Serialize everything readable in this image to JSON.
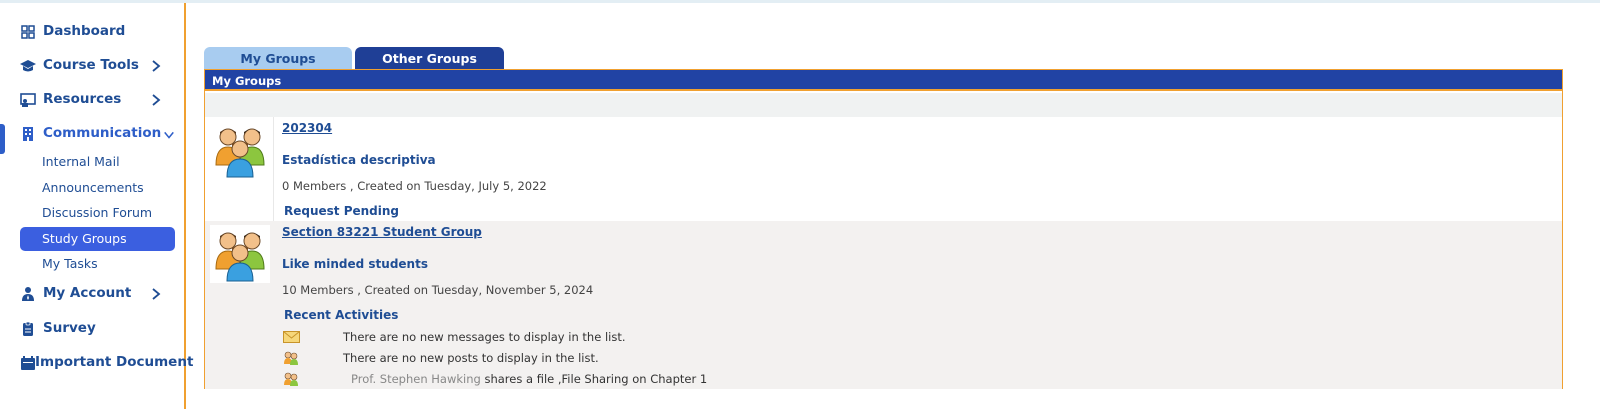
{
  "sidebar": {
    "items": [
      {
        "label": "Dashboard",
        "icon": "grid-icon"
      },
      {
        "label": "Course Tools",
        "icon": "graduation-cap-icon"
      },
      {
        "label": "Resources",
        "icon": "presentation-icon"
      },
      {
        "label": "Communication",
        "icon": "building-icon"
      },
      {
        "label": "My Account",
        "icon": "user-tie-icon"
      },
      {
        "label": "Survey",
        "icon": "clipboard-icon"
      },
      {
        "label": "Important Document",
        "icon": "calendar-icon"
      }
    ],
    "communication_sub": [
      {
        "label": "Internal Mail"
      },
      {
        "label": "Announcements"
      },
      {
        "label": "Discussion Forum"
      },
      {
        "label": "Study Groups"
      },
      {
        "label": "My Tasks"
      }
    ]
  },
  "tabs": {
    "my_groups": "My Groups",
    "other_groups": "Other Groups"
  },
  "panel": {
    "title": "My Groups"
  },
  "groups": [
    {
      "name": "202304",
      "description": "Estadística descriptiva",
      "meta": "0 Members , Created on Tuesday, July 5, 2022",
      "status": "Request Pending"
    },
    {
      "name": "Section 83221 Student Group",
      "description": "Like minded students",
      "meta": "10 Members , Created on Tuesday, November 5, 2024",
      "status": "Recent Activities",
      "activities": [
        {
          "icon": "envelope-icon",
          "text": "There are no new messages to display in the list."
        },
        {
          "icon": "people-icon",
          "text": "There are no new posts to display in the list."
        },
        {
          "icon": "people-icon",
          "author": "Prof. Stephen Hawking",
          "text": " shares a file ,File Sharing on Chapter 1"
        }
      ]
    }
  ],
  "colors": {
    "brand": "#1f4d94",
    "accent": "#f0a030",
    "header": "#2143a4",
    "selected": "#3b5fe0"
  }
}
